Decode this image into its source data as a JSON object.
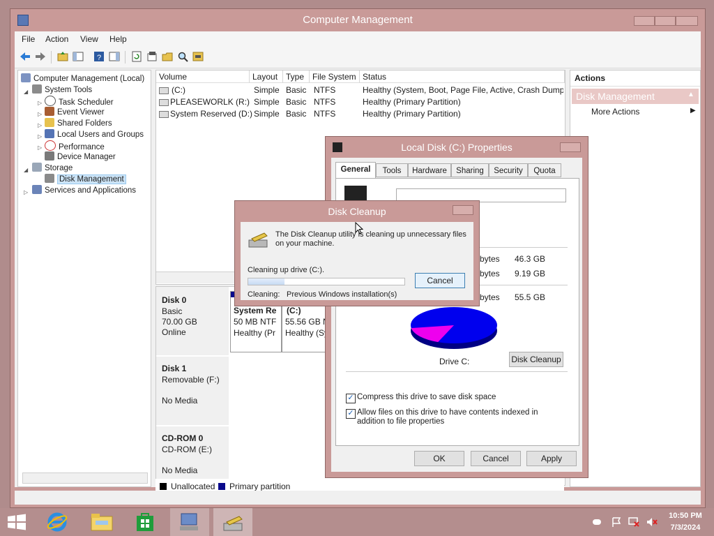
{
  "window": {
    "title": "Computer Management"
  },
  "menu": [
    "File",
    "Action",
    "View",
    "Help"
  ],
  "tree": {
    "root": "Computer Management (Local)",
    "items": [
      {
        "label": "System Tools",
        "icon": "tools-icon"
      },
      {
        "label": "Task Scheduler",
        "icon": "clock-icon"
      },
      {
        "label": "Event Viewer",
        "icon": "event-viewer-icon"
      },
      {
        "label": "Shared Folders",
        "icon": "folder-icon"
      },
      {
        "label": "Local Users and Groups",
        "icon": "users-icon"
      },
      {
        "label": "Performance",
        "icon": "performance-icon"
      },
      {
        "label": "Device Manager",
        "icon": "device-manager-icon"
      },
      {
        "label": "Storage",
        "icon": "storage-icon"
      },
      {
        "label": "Disk Management",
        "icon": "disk-icon"
      },
      {
        "label": "Services and Applications",
        "icon": "services-icon"
      }
    ]
  },
  "volumes": {
    "columns": [
      "Volume",
      "Layout",
      "Type",
      "File System",
      "Status"
    ],
    "rows": [
      [
        "(C:)",
        "Simple",
        "Basic",
        "NTFS",
        "Healthy (System, Boot, Page File, Active, Crash Dump,"
      ],
      [
        "PLEASEWORLK (R:)",
        "Simple",
        "Basic",
        "NTFS",
        "Healthy (Primary Partition)"
      ],
      [
        "System Reserved (D:)",
        "Simple",
        "Basic",
        "NTFS",
        "Healthy (Primary Partition)"
      ]
    ]
  },
  "disks": [
    {
      "name": "Disk 0",
      "lines": [
        "Basic",
        "70.00 GB",
        "Online"
      ]
    },
    {
      "name": "Disk 1",
      "lines": [
        "Removable (F:)",
        "",
        "No Media"
      ]
    },
    {
      "name": "CD-ROM 0",
      "lines": [
        "CD-ROM (E:)",
        "",
        "No Media"
      ]
    }
  ],
  "partitions": [
    {
      "name": "System Re",
      "size": "50 MB NTF",
      "status": "Healthy (Pr"
    },
    {
      "name": "(C:)",
      "size": "55.56 GB NT",
      "status": "Healthy (Sy"
    }
  ],
  "legend": {
    "unallocated": "Unallocated",
    "primary": "Primary partition"
  },
  "actions": {
    "header": "Actions",
    "section": "Disk Management",
    "more": "More Actions"
  },
  "props": {
    "title": "Local Disk (C:) Properties",
    "tabs": [
      "General",
      "Tools",
      "Hardware",
      "Sharing",
      "Security",
      "Quota"
    ],
    "sizes": [
      {
        "unit": "bytes",
        "value": "46.3 GB"
      },
      {
        "unit": "bytes",
        "value": "9.19 GB"
      },
      {
        "unit": "bytes",
        "value": "55.5 GB"
      }
    ],
    "drive_label": "Drive C:",
    "cleanup_btn": "Disk Cleanup",
    "compress": "Compress this drive to save disk space",
    "index": "Allow files on this drive to have contents indexed in addition to file properties",
    "ok": "OK",
    "cancel": "Cancel",
    "apply": "Apply",
    "used_fraction": 0.835,
    "colors": {
      "used": "#0000ee",
      "free": "#ee00ee"
    }
  },
  "cleanup": {
    "title": "Disk Cleanup",
    "message": "The Disk Cleanup utility is cleaning up unnecessary files on your machine.",
    "status": "Cleaning up drive  (C:).",
    "cleaning_label": "Cleaning:",
    "cleaning_item": "Previous Windows installation(s)",
    "cancel": "Cancel",
    "progress": 0.23
  },
  "clock": {
    "time": "10:50 PM",
    "date": "7/3/2024"
  }
}
